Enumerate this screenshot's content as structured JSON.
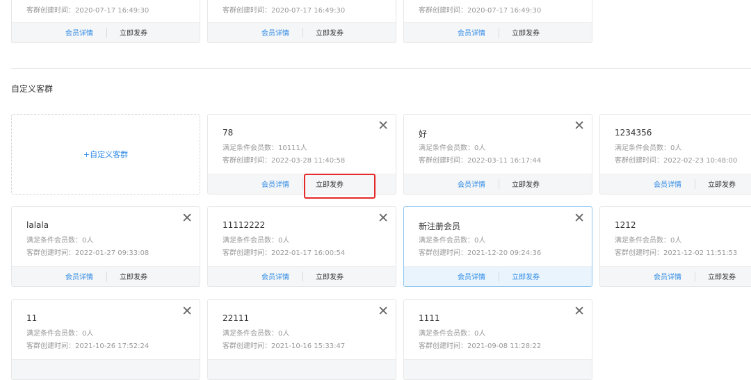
{
  "top_cards": [
    {
      "line2": "客群创建时间：2020-07-17 16:49:30",
      "detail": "会员详情",
      "issue": "立即发券"
    },
    {
      "line2": "客群创建时间：2020-07-17 16:49:30",
      "detail": "会员详情",
      "issue": "立即发券"
    },
    {
      "line2": "客群创建时间：2020-07-17 16:49:30",
      "detail": "会员详情",
      "issue": "立即发券"
    }
  ],
  "section_title": "自定义客群",
  "add_card_label": "+自定义客群",
  "close_glyph": "✕",
  "cards": [
    {
      "name": "78",
      "line1": "满足条件会员数：10111人",
      "line2": "客群创建时间：2022-03-28 11:40:58",
      "detail": "会员详情",
      "issue": "立即发券"
    },
    {
      "name": "好",
      "line1": "满足条件会员数：0人",
      "line2": "客群创建时间：2022-03-11 16:17:44",
      "detail": "会员详情",
      "issue": "立即发券"
    },
    {
      "name": "1234356",
      "line1": "满足条件会员数：0人",
      "line2": "客群创建时间：2022-02-23 10:48:00",
      "detail": "会员详情",
      "issue": "立即发券"
    },
    {
      "name": "lalala",
      "line1": "满足条件会员数：0人",
      "line2": "客群创建时间：2022-01-27 09:33:08",
      "detail": "会员详情",
      "issue": "立即发券"
    },
    {
      "name": "11112222",
      "line1": "满足条件会员数：0人",
      "line2": "客群创建时间：2022-01-17 16:00:54",
      "detail": "会员详情",
      "issue": "立即发券"
    },
    {
      "name": "新注册会员",
      "line1": "满足条件会员数：0人",
      "line2": "客群创建时间：2021-12-20 09:24:36",
      "detail": "会员详情",
      "issue": "立即发券"
    },
    {
      "name": "1212",
      "line1": "满足条件会员数：0人",
      "line2": "客群创建时间：2021-12-02 11:51:53",
      "detail": "会员详情",
      "issue": "立即发券"
    },
    {
      "name": "11",
      "line1": "满足条件会员数：0人",
      "line2": "客群创建时间：2021-10-26 17:52:24"
    },
    {
      "name": "22111",
      "line1": "满足条件会员数：0人",
      "line2": "客群创建时间：2021-10-16 15:33:47"
    },
    {
      "name": "1111",
      "line1": "满足条件会员数：0人",
      "line2": "客群创建时间：2021-09-08 11:28:22"
    }
  ],
  "colors": {
    "link": "#2e8ae6",
    "highlight": "#e52828",
    "selected_border": "#8cc5ee"
  }
}
